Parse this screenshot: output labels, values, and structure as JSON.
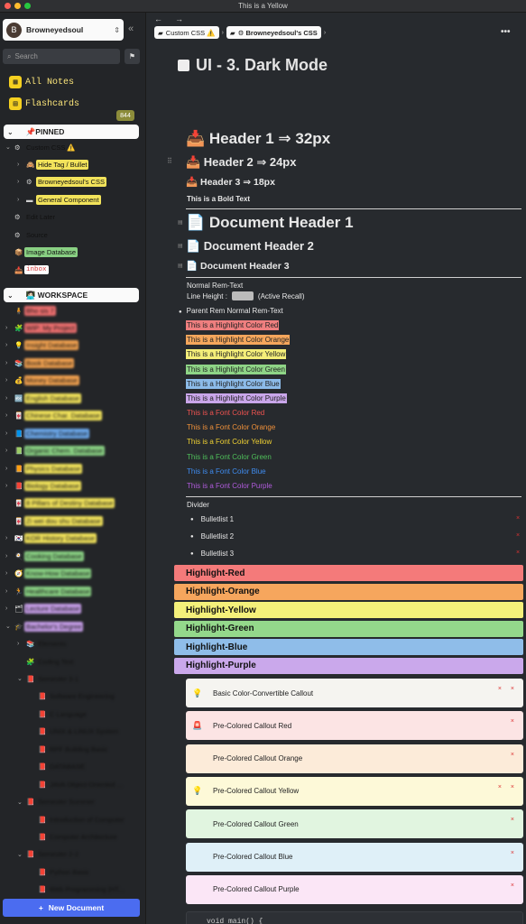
{
  "window": {
    "title": "This is a Yellow"
  },
  "sidebar": {
    "workspace_name": "Browneyedsoul",
    "avatar_letter": "B",
    "search_placeholder": "Search",
    "all_notes": "All Notes",
    "flashcards": "Flashcards",
    "flashcards_count": "844",
    "pinned_title": "📌PINNED",
    "workspace_title": "👩🏻‍💻 WORKSPACE",
    "new_document": "New Document",
    "pinned_items": [
      {
        "label": "Custom CSS ⚠️",
        "icon": "⚙",
        "level": 0,
        "chev": "⌄",
        "style": ""
      },
      {
        "label": "Hide Tag / Bullet",
        "icon": "🙈",
        "level": 1,
        "chev": "›",
        "style": "tag-yellow"
      },
      {
        "label": "Browneyedsoul's CSS",
        "icon": "⚙",
        "level": 1,
        "chev": "›",
        "style": "tag-yellow"
      },
      {
        "label": "General Component",
        "icon": "▬",
        "level": 1,
        "chev": "›",
        "style": "tag-yellow"
      },
      {
        "label": "Edit Later",
        "icon": "⚙",
        "level": 0,
        "chev": "",
        "style": ""
      },
      {
        "label": "Source",
        "icon": "⚙",
        "level": 0,
        "chev": "",
        "style": ""
      },
      {
        "label": "Image Database",
        "icon": "📦",
        "level": 0,
        "chev": "",
        "style": "tag-green"
      },
      {
        "label": "inbox",
        "icon": "📥",
        "level": 0,
        "chev": "",
        "style": "tag-inbox"
      }
    ],
    "workspace_items": [
      {
        "label": "Bho sis 7",
        "icon": "🧍",
        "level": 0,
        "chev": "",
        "style": "tag-red"
      },
      {
        "label": "WIP: My Project",
        "icon": "🧩",
        "level": 0,
        "chev": "›",
        "style": "tag-red"
      },
      {
        "label": "Insight Database",
        "icon": "💡",
        "level": 0,
        "chev": "›",
        "style": "tag-orange"
      },
      {
        "label": "Book Database",
        "icon": "📚",
        "level": 0,
        "chev": "›",
        "style": "tag-orange"
      },
      {
        "label": "Money Database",
        "icon": "💰",
        "level": 0,
        "chev": "›",
        "style": "tag-orange"
      },
      {
        "label": "English Database",
        "icon": "🔤",
        "level": 0,
        "chev": "›",
        "style": "tag-yellow"
      },
      {
        "label": "Chinese Char. Database",
        "icon": "🀄",
        "level": 0,
        "chev": "›",
        "style": "tag-yellow"
      },
      {
        "label": "Chemistry Database",
        "icon": "📘",
        "level": 0,
        "chev": "›",
        "style": "tag-blue"
      },
      {
        "label": "Organic Chem. Database",
        "icon": "📗",
        "level": 0,
        "chev": "›",
        "style": "tag-green"
      },
      {
        "label": "Physics Database",
        "icon": "📙",
        "level": 0,
        "chev": "›",
        "style": "tag-yellow"
      },
      {
        "label": "Biology Database",
        "icon": "📕",
        "level": 0,
        "chev": "›",
        "style": "tag-yellow"
      },
      {
        "label": "8 Pillars of Destiny Database",
        "icon": "🀄",
        "level": 0,
        "chev": "",
        "style": "tag-yellow"
      },
      {
        "label": "Zi wei dou shu Database",
        "icon": "🀄",
        "level": 0,
        "chev": "",
        "style": "tag-yellow"
      },
      {
        "label": "KOR History Database",
        "icon": "🇰🇷",
        "level": 0,
        "chev": "›",
        "style": "tag-yellow"
      },
      {
        "label": "Cooking Database",
        "icon": "🍳",
        "level": 0,
        "chev": "›",
        "style": "tag-green"
      },
      {
        "label": "Know-How Database",
        "icon": "🧭",
        "level": 0,
        "chev": "›",
        "style": "tag-green"
      },
      {
        "label": "Healthcare Database",
        "icon": "🏃",
        "level": 0,
        "chev": "›",
        "style": "tag-green"
      },
      {
        "label": "Lecture Database",
        "icon": "🗂",
        "level": 0,
        "chev": "›",
        "style": "tag-purple"
      },
      {
        "label": "Bachelor's Degree",
        "icon": "🎓",
        "level": 0,
        "chev": "⌄",
        "style": "tag-purple"
      },
      {
        "label": "Elements",
        "icon": "📚",
        "level": 1,
        "chev": "›",
        "style": ""
      },
      {
        "label": "Coding Test",
        "icon": "🧩",
        "level": 1,
        "chev": "",
        "style": ""
      },
      {
        "label": "Semester 3-1",
        "icon": "📕",
        "level": 1,
        "chev": "⌄",
        "style": ""
      },
      {
        "label": "Software Engineering",
        "icon": "📕",
        "level": 2,
        "chev": "",
        "style": ""
      },
      {
        "label": "C Language",
        "icon": "📕",
        "level": 2,
        "chev": "",
        "style": ""
      },
      {
        "label": "UNIX & LINUX System",
        "icon": "📕",
        "level": 2,
        "chev": "",
        "style": ""
      },
      {
        "label": "RPF Building Basic",
        "icon": "📕",
        "level": 2,
        "chev": "",
        "style": ""
      },
      {
        "label": "DATABASE",
        "icon": "📕",
        "level": 2,
        "chev": "",
        "style": ""
      },
      {
        "label": "JAVA Object-Oriented ...",
        "icon": "📕",
        "level": 2,
        "chev": "",
        "style": ""
      },
      {
        "label": "Semester Summer",
        "icon": "📕",
        "level": 1,
        "chev": "⌄",
        "style": ""
      },
      {
        "label": "Introduction of Computer",
        "icon": "📕",
        "level": 2,
        "chev": "",
        "style": ""
      },
      {
        "label": "Computer Architecture",
        "icon": "📕",
        "level": 2,
        "chev": "",
        "style": ""
      },
      {
        "label": "Semester 2-2",
        "icon": "📕",
        "level": 1,
        "chev": "⌄",
        "style": ""
      },
      {
        "label": "Python Basic",
        "icon": "📕",
        "level": 2,
        "chev": "",
        "style": ""
      },
      {
        "label": "Web Programming (HT...",
        "icon": "📕",
        "level": 2,
        "chev": "",
        "style": ""
      }
    ]
  },
  "editor": {
    "nav_back": "←",
    "nav_forward": "→",
    "breadcrumbs": [
      "Custom CSS ⚠️",
      "⚙ Browneyedsoul's CSS"
    ],
    "more": "•••",
    "doc_title": "UI - 3. Dark Mode",
    "h1": "📥 Header 1 ⇒ 32px",
    "h2": "📥 Header 2 ⇒ 24px",
    "h3": "📥 Header 3 ⇒ 18px",
    "bold": "This is a Bold Text",
    "doc_h1": "📄 Document Header 1",
    "doc_h2": "📄 Document Header 2",
    "doc_h3": "📄 Document Header 3",
    "normal_rem": "Normal Rem-Text",
    "line_height_prefix": "Line Height :",
    "line_height_suffix": "(Active Recall)",
    "parent_rem": "Parent Rem Normal Rem-Text",
    "highlights": [
      {
        "text": "This is a Highlight Color Red",
        "color": "#ef7f7f"
      },
      {
        "text": "This is a Highlight Color Orange",
        "color": "#f5a65c"
      },
      {
        "text": "This is a Highlight Color Yellow",
        "color": "#f4ee79"
      },
      {
        "text": "This is a Highlight Color Green",
        "color": "#8ed486"
      },
      {
        "text": "This is a Highlight Color Blue",
        "color": "#8cbbe9"
      },
      {
        "text": "This is a Highlight Color Purple",
        "color": "#c9a6ea"
      }
    ],
    "font_colors": [
      {
        "text": "This is a Font Color Red",
        "color": "#ef5350"
      },
      {
        "text": "This is a Font Color Orange",
        "color": "#f0913a"
      },
      {
        "text": "This is a Font Color Yellow",
        "color": "#f1d233"
      },
      {
        "text": "This is a Font Color Green",
        "color": "#4fbf5a"
      },
      {
        "text": "This is a Font Color Blue",
        "color": "#3f8cf0"
      },
      {
        "text": "This is a Font Color Purple",
        "color": "#b05bdc"
      }
    ],
    "divider": "Divider",
    "bullets": [
      "Bulletlist 1",
      "Bulletlist 2",
      "Bulletlist 3"
    ],
    "bars": [
      {
        "text": "Highlight-Red",
        "color": "#f47a7a"
      },
      {
        "text": "Highlight-Orange",
        "color": "#f6a65d"
      },
      {
        "text": "Highlight-Yellow",
        "color": "#f4f07a"
      },
      {
        "text": "Highlight-Green",
        "color": "#94d88b"
      },
      {
        "text": "Highlight-Blue",
        "color": "#8fbde9"
      },
      {
        "text": "Highlight-Purple",
        "color": "#caa8eb"
      }
    ],
    "callouts": [
      {
        "text": "Basic Color-Convertible Callout",
        "icon": "💡",
        "color": "#f5f4f0"
      },
      {
        "text": "Pre-Colored Callout Red",
        "icon": "🚨",
        "color": "#fce4e4"
      },
      {
        "text": "Pre-Colored Callout Orange",
        "icon": "",
        "color": "#fcebd9"
      },
      {
        "text": "Pre-Colored Callout Yellow",
        "icon": "💡",
        "color": "#fdf9d8"
      },
      {
        "text": "Pre-Colored Callout Green",
        "icon": "",
        "color": "#e1f5e0"
      },
      {
        "text": "Pre-Colored Callout Blue",
        "icon": "",
        "color": "#dff0f8"
      },
      {
        "text": "Pre-Colored Callout Purple",
        "icon": "",
        "color": "#fbe6f6"
      }
    ],
    "code": "void main() {"
  }
}
